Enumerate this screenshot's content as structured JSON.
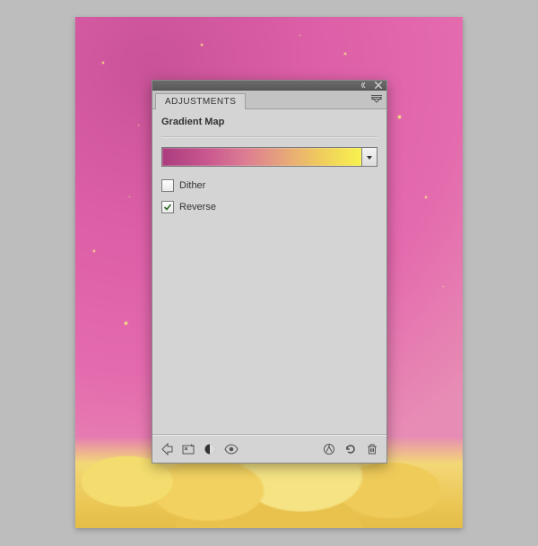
{
  "panel": {
    "tab_label": "ADJUSTMENTS",
    "section_title": "Gradient Map",
    "gradient_stops": [
      "#aa3d7f",
      "#c8578f",
      "#dd7d93",
      "#e6a37c",
      "#efc95e",
      "#f8f24e"
    ],
    "options": {
      "dither": {
        "label": "Dither",
        "checked": false
      },
      "reverse": {
        "label": "Reverse",
        "checked": true
      }
    },
    "footer_icons": {
      "back": "back-arrow-icon",
      "expand": "expand-view-icon",
      "layer_mask": "layer-mask-icon",
      "visibility": "eye-icon",
      "clip": "clip-to-layer-icon",
      "reset": "reset-icon",
      "delete": "trash-icon"
    }
  }
}
